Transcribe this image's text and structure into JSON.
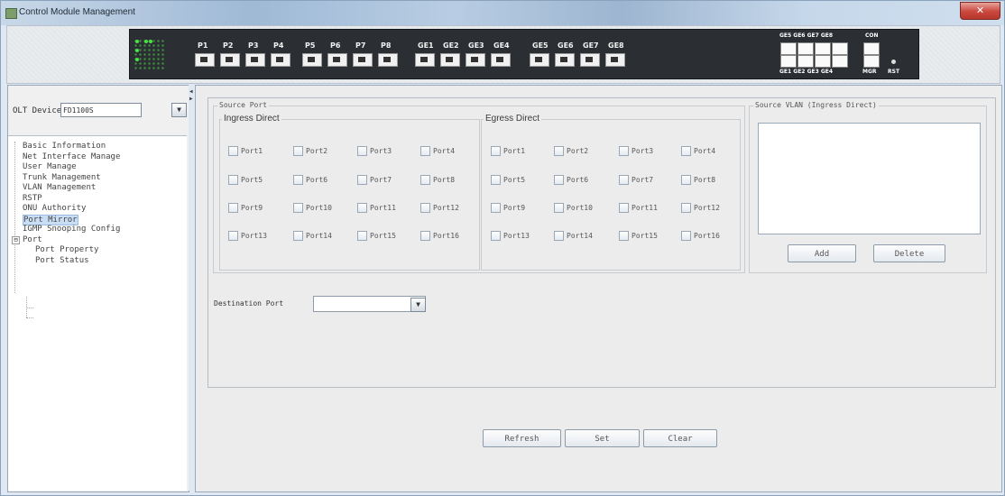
{
  "window": {
    "title": "Control Module Management",
    "close_label": "✕"
  },
  "device_panel": {
    "port_labels": [
      "P1",
      "P2",
      "P3",
      "P4",
      "P5",
      "P6",
      "P7",
      "P8",
      "GE1",
      "GE2",
      "GE3",
      "GE4",
      "GE5",
      "GE6",
      "GE7",
      "GE8"
    ],
    "uplink_top_labels": "GE5 GE6 GE7 GE8",
    "uplink_bottom_labels": "GE1 GE2 GE3 GE4",
    "con_label": "CON",
    "mgr_label": "MGR",
    "rst_label": "RST",
    "led_color": "#4be04b"
  },
  "sidebar": {
    "olt_label": "OLT Device",
    "olt_value": "FD1100S",
    "tree": [
      "Basic Information",
      "Net Interface Manage",
      "User Manage",
      "Trunk Management",
      "VLAN Management",
      "RSTP",
      "ONU Authority",
      "Port Mirror",
      "IGMP Snooping Config",
      "Port",
      "Port Property",
      "Port Status"
    ],
    "selected": "Port Mirror",
    "port_expander": "⊟"
  },
  "source_port": {
    "legend": "Source Port",
    "ingress_label": "Ingress Direct",
    "egress_label": "Egress Direct",
    "ingress_ports": [
      "Port1",
      "Port2",
      "Port3",
      "Port4",
      "Port5",
      "Port6",
      "Port7",
      "Port8",
      "Port9",
      "Port10",
      "Port11",
      "Port12",
      "Port13",
      "Port14",
      "Port15",
      "Port16"
    ],
    "egress_ports": [
      "Port1",
      "Port2",
      "Port3",
      "Port4",
      "Port5",
      "Port6",
      "Port7",
      "Port8",
      "Port9",
      "Port10",
      "Port11",
      "Port12",
      "Port13",
      "Port14",
      "Port15",
      "Port16"
    ]
  },
  "source_vlan": {
    "legend": "Source VLAN (Ingress Direct)",
    "add_label": "Add",
    "delete_label": "Delete"
  },
  "destination": {
    "label": "Destination Port",
    "value": ""
  },
  "actions": {
    "refresh_label": "Refresh",
    "set_label": "Set",
    "clear_label": "Clear"
  }
}
